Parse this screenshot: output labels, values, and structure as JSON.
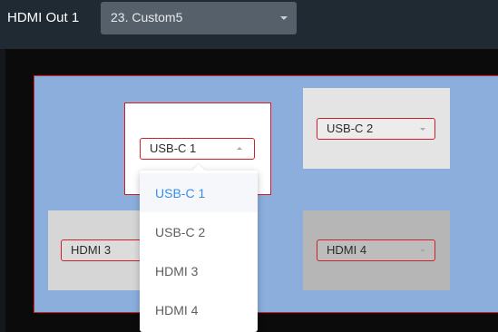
{
  "header": {
    "output_label": "HDMI Out 1",
    "preset_value": "23. Custom5"
  },
  "windows": [
    {
      "source": "USB-C 1"
    },
    {
      "source": "USB-C 2"
    },
    {
      "source": "HDMI 3"
    },
    {
      "source": "HDMI 4"
    }
  ],
  "dropdown": {
    "options": [
      "USB-C 1",
      "USB-C 2",
      "HDMI 3",
      "HDMI 4"
    ],
    "selected": "USB-C 1"
  },
  "colors": {
    "accent": "#3b8ee8",
    "outline": "#d01f2a",
    "canvas": "#8caedd",
    "topbar": "#1f2a33"
  }
}
